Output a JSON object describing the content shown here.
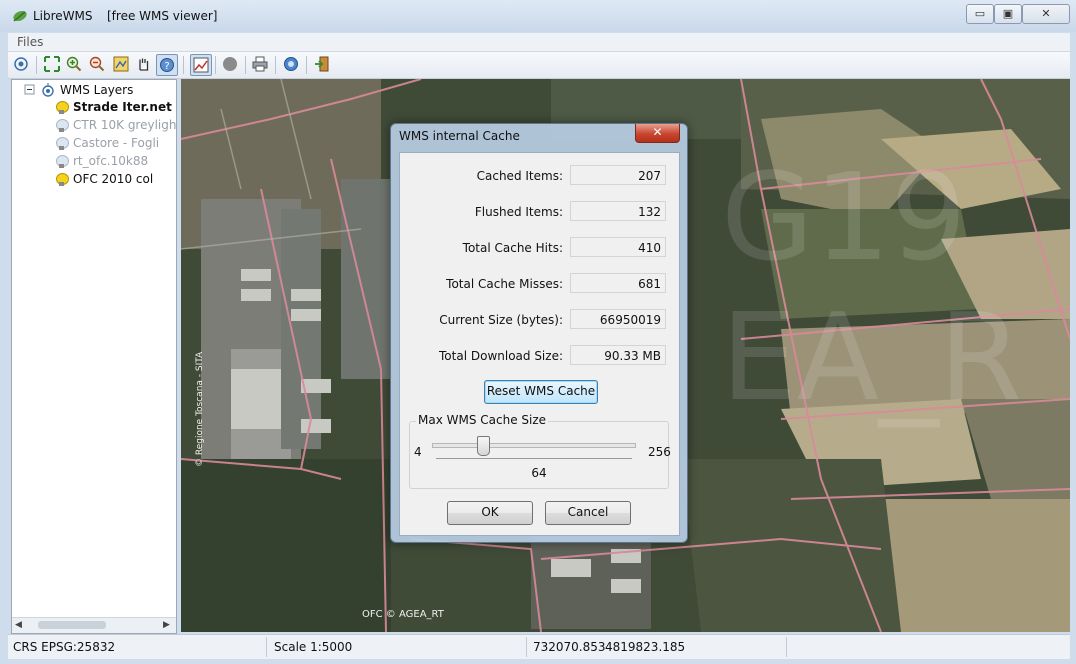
{
  "window": {
    "app_name": "LibreWMS",
    "subtitle": "[free WMS viewer]",
    "controls": {
      "minimize": "▭",
      "restore": "▣",
      "close": "✕"
    }
  },
  "menu": {
    "files": "Files"
  },
  "toolbar": {
    "icons": [
      "wms-connect-icon",
      "zoom-extent-icon",
      "zoom-in-icon",
      "zoom-out-icon",
      "zoom-layer-icon",
      "pan-hand-icon",
      "identify-icon",
      "graph-icon",
      "stop-icon",
      "print-icon",
      "info-icon",
      "exit-icon"
    ]
  },
  "tree": {
    "root": "WMS Layers",
    "items": [
      {
        "label": "Strade Iter.net",
        "state": "on"
      },
      {
        "label": "CTR 10K greyligh",
        "state": "off"
      },
      {
        "label": "Castore - Fogli",
        "state": "off"
      },
      {
        "label": "rt_ofc.10k88",
        "state": "off"
      },
      {
        "label": "OFC 2010 col",
        "state": "on"
      }
    ],
    "scroll_left": "◀",
    "scroll_right": "▶"
  },
  "map": {
    "credit_left": "© Regione Toscana - SITA",
    "credit_bottom": "OFC © AGEA_RT"
  },
  "status": {
    "crs": "CRS EPSG:25832",
    "scale": "Scale 1:5000",
    "x": "732070.853",
    "y": "4819823.185"
  },
  "dialog": {
    "title": "WMS internal Cache",
    "close": "✕",
    "fields": [
      {
        "label": "Cached Items:",
        "value": "207"
      },
      {
        "label": "Flushed Items:",
        "value": "132"
      },
      {
        "label": "Total Cache Hits:",
        "value": "410"
      },
      {
        "label": "Total Cache Misses:",
        "value": "681"
      },
      {
        "label": "Current Size (bytes):",
        "value": "66950019"
      },
      {
        "label": "Total Download Size:",
        "value": "90.33 MB"
      }
    ],
    "reset_label": "Reset WMS Cache",
    "group_title": "Max WMS Cache Size",
    "slider": {
      "min": "4",
      "max": "256",
      "value": "64"
    },
    "ok": "OK",
    "cancel": "Cancel"
  },
  "colors": {
    "road": "#d98a9a",
    "map_dark": "#3e4a36",
    "field": "#b9ae8c",
    "dialog_frame": "#b9cde4"
  }
}
